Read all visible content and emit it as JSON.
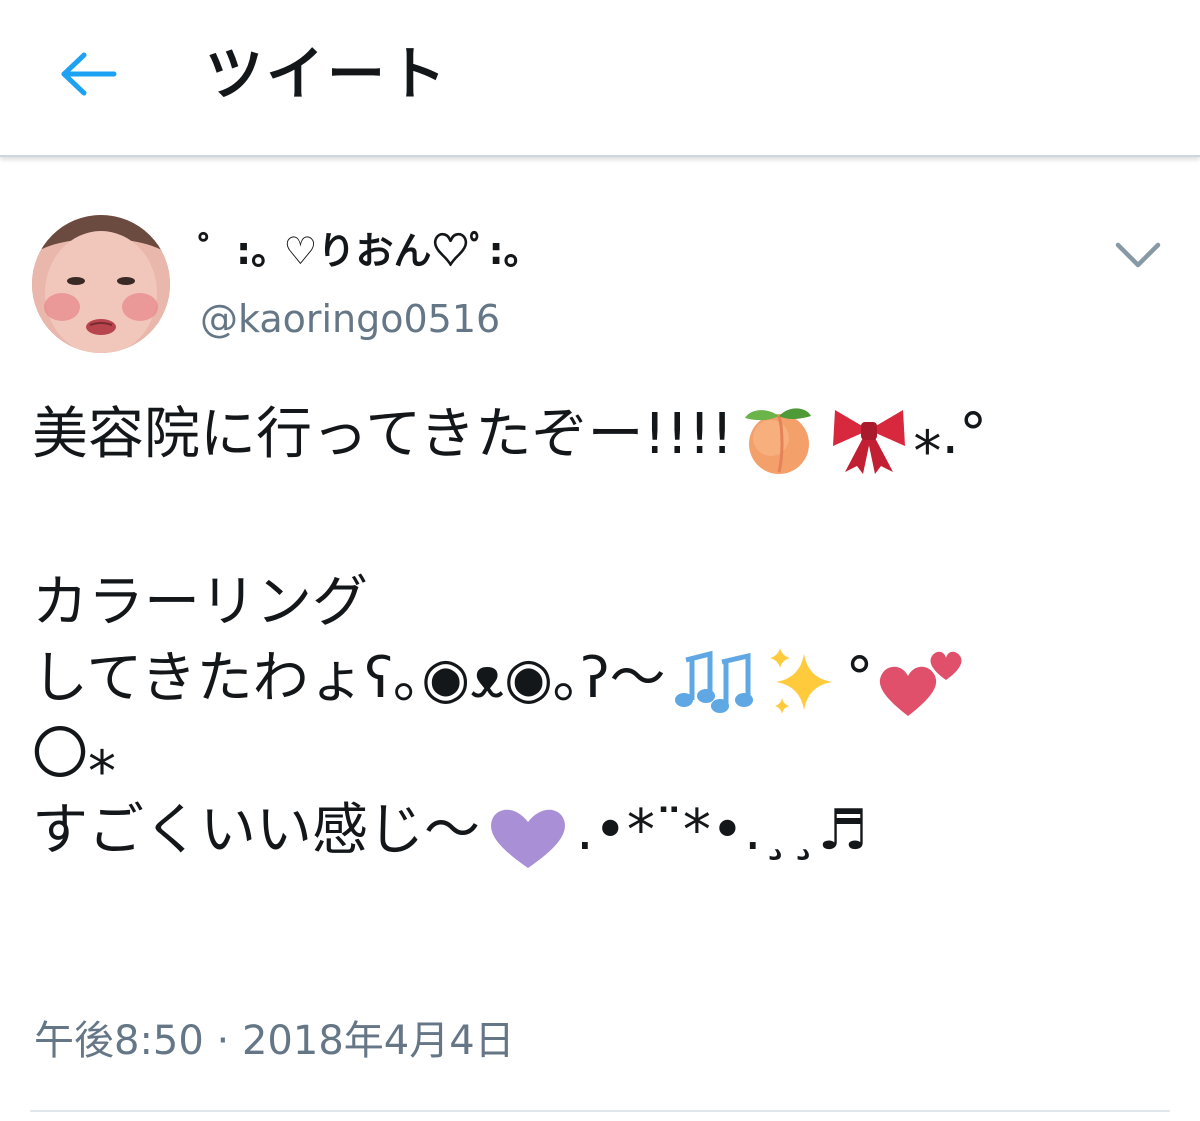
{
  "header": {
    "back_icon": "arrow-left-icon",
    "title": "ツイート"
  },
  "tweet": {
    "author": {
      "display_name": "゜:｡ ♡りおん♡ﾟ:｡",
      "handle": "@kaoringo0516",
      "avatar": "user-avatar-photo"
    },
    "menu_icon": "chevron-down-icon",
    "body": {
      "line1_text": "美容院に行ってきたぞー!!!!",
      "line1_emojis": [
        "peach-emoji",
        "ribbon-emoji"
      ],
      "line1_tail": "⁎.°",
      "line2": "カラーリング",
      "line3_text": "してきたわょʕ｡◉ᴥ◉｡ʔ〜",
      "line3_emojis": [
        "musical-notes-emoji",
        "sparkles-emoji"
      ],
      "line3_mid": "°",
      "line3_end_emoji": "two-hearts-emoji",
      "line4": "〇⁎",
      "line5_text": "すごくいい感じ〜",
      "line5_emoji": "purple-heart-emoji",
      "line5_tail": ".•*¨*•.¸¸♬"
    },
    "timestamp": "午後8:50 · 2018年4月4日"
  },
  "colors": {
    "accent": "#1da1f2",
    "text": "#14171a",
    "secondary_text": "#657786",
    "divider": "#e1e8ed"
  }
}
